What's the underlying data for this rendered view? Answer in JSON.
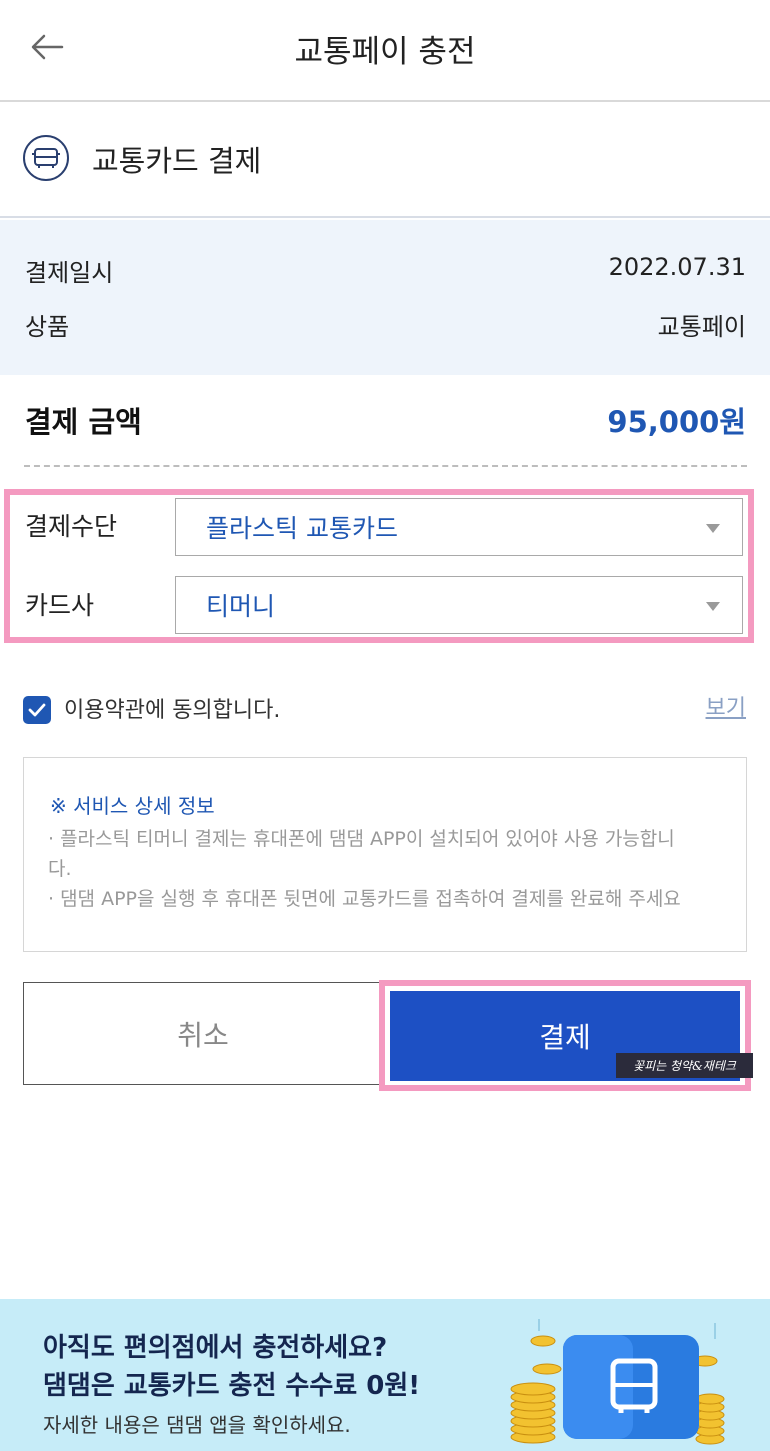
{
  "header": {
    "title": "교통페이 충전"
  },
  "method": {
    "title": "교통카드 결제",
    "icon": "bus-icon"
  },
  "info": {
    "date_label": "결제일시",
    "date_value": "2022.07.31",
    "product_label": "상품",
    "product_value": "교통페이"
  },
  "amount": {
    "label": "결제 금액",
    "value": "95,000원"
  },
  "payment_method": {
    "label": "결제수단",
    "selected": "플라스틱 교통카드"
  },
  "card_company": {
    "label": "카드사",
    "selected": "티머니"
  },
  "terms": {
    "text": "이용약관에 동의합니다.",
    "view_label": "보기",
    "checked": true
  },
  "notice": {
    "title": "※ 서비스 상세 정보",
    "lines": [
      "· 플라스틱 티머니 결제는 휴대폰에 댐댐 APP이 설치되어 있어야 사용 가능합니",
      "  다.",
      "· 댐댐 APP을 실행 후 휴대폰 뒷면에 교통카드를 접촉하여 결제를 완료해 주세요"
    ]
  },
  "buttons": {
    "cancel": "취소",
    "pay": "결제"
  },
  "watermark": "꽃피는 청약&재테크",
  "banner": {
    "line1": "아직도 편의점에서 충전하세요?",
    "line2": "댐댐은 교통카드 충전 수수료 0원!",
    "sub": "자세한 내용은 댐댐 앱을 확인하세요."
  },
  "colors": {
    "accent": "#1f57b3",
    "pay_button": "#1d50c4",
    "highlight": "#f49ac0",
    "banner_bg": "#c6ecf8"
  }
}
